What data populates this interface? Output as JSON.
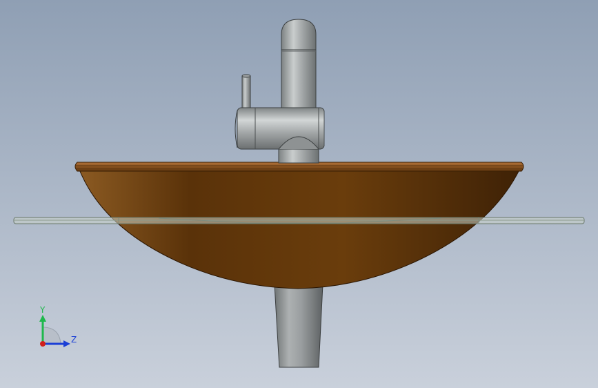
{
  "viewport": {
    "background_top": "#8f9fb4",
    "background_bottom": "#c9d0db"
  },
  "model": {
    "basin_color": "#6e3e0a",
    "basin_rim_color": "#a0642a",
    "metal_color": "#a9adae",
    "shelf_color": "#c9d1c9"
  },
  "triad": {
    "y_label": "Y",
    "z_label": "Z",
    "y_color": "#1fb84c",
    "z_color": "#1b3fd6",
    "x_color": "#d0201c"
  }
}
